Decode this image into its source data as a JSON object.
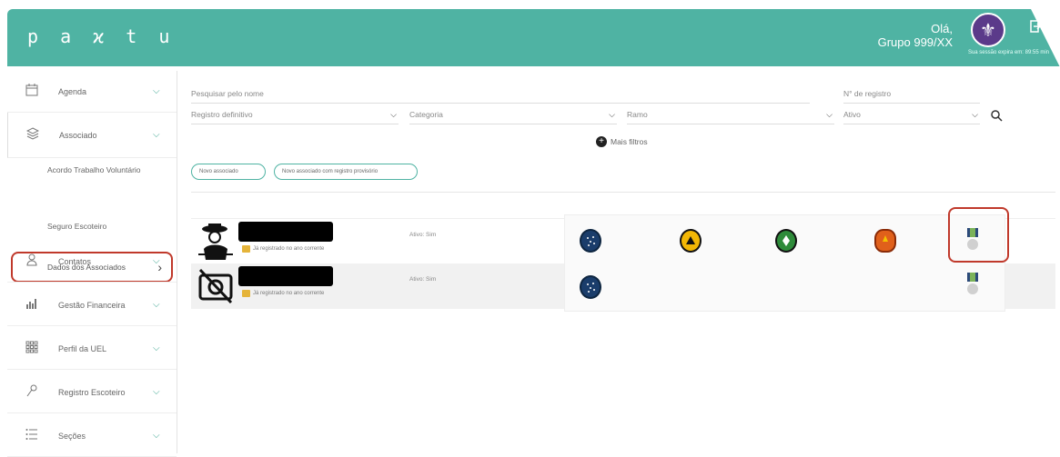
{
  "header": {
    "logo": "p a ϰ t u",
    "greeting": "Olá,",
    "group": "Grupo 999/XX",
    "session": "Sua sessão expira em: 89:55 min"
  },
  "sidebar": {
    "items": [
      {
        "label": "Agenda",
        "icon": "calendar-icon"
      },
      {
        "label": "Associado",
        "icon": "layers-icon"
      },
      {
        "label": "Contatos",
        "icon": "person-icon"
      },
      {
        "label": "Gestão Financeira",
        "icon": "bar-chart-icon"
      },
      {
        "label": "Perfil da UEL",
        "icon": "grid-icon"
      },
      {
        "label": "Registro Escoteiro",
        "icon": "key-icon"
      },
      {
        "label": "Seções",
        "icon": "list-icon"
      }
    ],
    "subitems": [
      "Acordo Trabalho Voluntário",
      "Dados dos Associados",
      "Seguro Escoteiro"
    ]
  },
  "filters": {
    "name_placeholder": "Pesquisar pelo nome",
    "registro_placeholder": "N° de registro",
    "registro_tipo": "Registro definitivo",
    "categoria": "Categoria",
    "ramo": "Ramo",
    "ativo": "Ativo",
    "more": "Mais filtros"
  },
  "actions": {
    "novo": "Novo associado",
    "novo_provisorio": "Novo associado com registro provisório"
  },
  "members": [
    {
      "registered": "Já registrado no ano corrente",
      "status": "Ativo: Sim"
    },
    {
      "registered": "Já registrado no ano corrente",
      "status": "Ativo: Sim"
    }
  ],
  "colors": {
    "brand": "#4fb3a3",
    "highlight": "#c0392b"
  }
}
